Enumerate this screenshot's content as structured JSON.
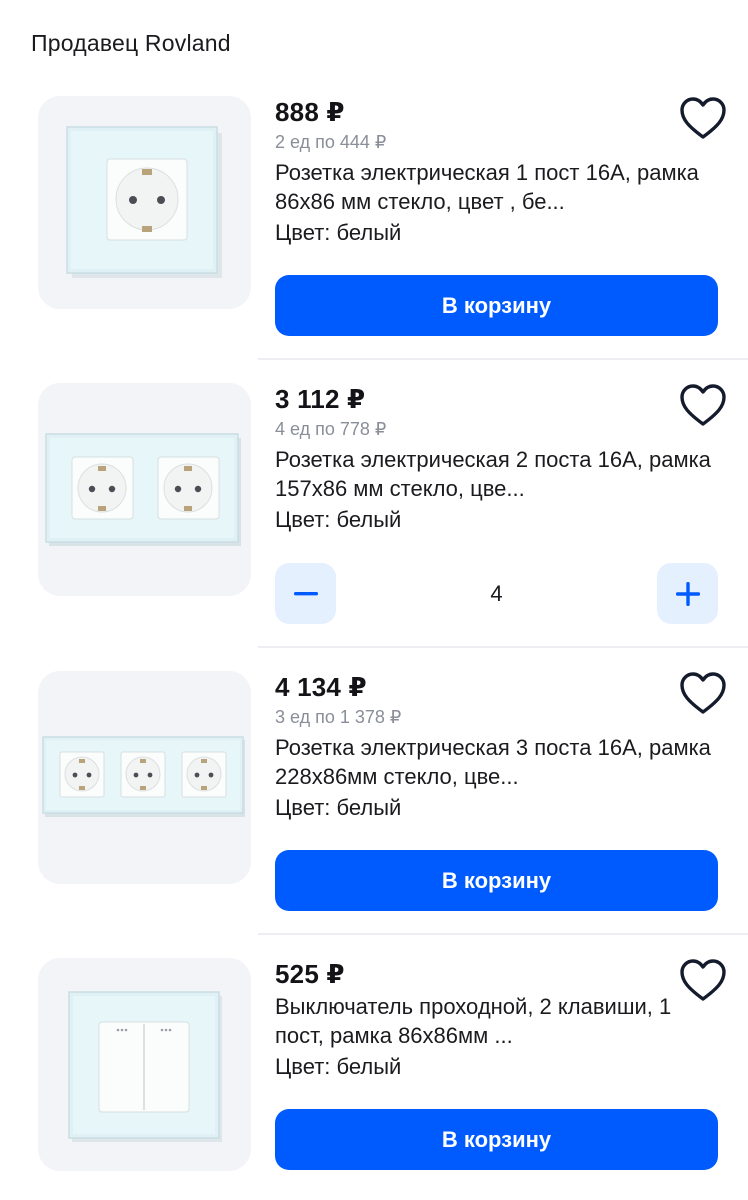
{
  "seller": {
    "label": "Продавец Rovland"
  },
  "products": [
    {
      "price": "888 ₽",
      "unit_price": "2 ед по 444 ₽",
      "title": "Розетка электрическая 1 пост 16А, рамка 86х86 мм стекло, цвет , бе...",
      "color": "Цвет: белый",
      "action": "В корзину"
    },
    {
      "price": "3 112 ₽",
      "unit_price": "4 ед по 778 ₽",
      "title": "Розетка электрическая 2 поста 16А, рамка 157х86 мм стекло, цве...",
      "color": "Цвет: белый",
      "quantity": "4"
    },
    {
      "price": "4 134 ₽",
      "unit_price": "3 ед по 1 378 ₽",
      "title": "Розетка электрическая 3 поста 16А, рамка 228х86мм стекло, цве...",
      "color": "Цвет: белый",
      "action": "В корзину"
    },
    {
      "price": "525 ₽",
      "title": "Выключатель проходной, 2 клавиши, 1 пост, рамка 86х86мм ...",
      "color": "Цвет: белый",
      "action": "В корзину"
    }
  ],
  "icons": {
    "favorite": "heart-outline-icon",
    "decrease": "minus-icon",
    "increase": "plus-icon"
  },
  "colors": {
    "accent": "#005bff",
    "stepper_bg": "#e5f0ff",
    "muted_text": "#8a8e99",
    "thumb_bg": "#f3f4f7"
  }
}
